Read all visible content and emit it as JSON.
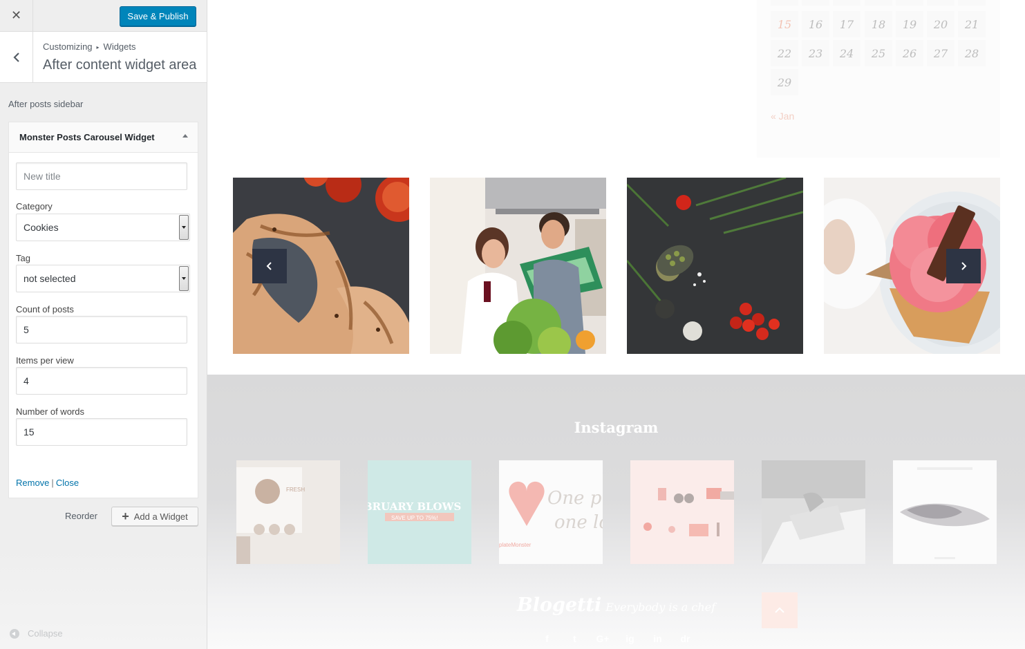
{
  "sidebar": {
    "publish_label": "Save & Publish",
    "breadcrumb_root": "Customizing",
    "breadcrumb_child": "Widgets",
    "section_title": "After content widget area",
    "area_description": "After posts sidebar",
    "reorder_label": "Reorder",
    "add_widget_label": "Add a Widget",
    "collapse_label": "Collapse"
  },
  "widget": {
    "title": "Monster Posts Carousel Widget",
    "title_field_placeholder": "New title",
    "category_label": "Category",
    "category_value": "Cookies",
    "tag_label": "Tag",
    "tag_value": "not selected",
    "count_label": "Count of posts",
    "count_value": "5",
    "items_label": "Items per view",
    "items_value": "4",
    "words_label": "Number of words",
    "words_value": "15",
    "remove_label": "Remove",
    "close_label": "Close"
  },
  "calendar": {
    "rows": [
      [
        "15",
        "16",
        "17",
        "18",
        "19",
        "20",
        "21"
      ],
      [
        "22",
        "23",
        "24",
        "25",
        "26",
        "27",
        "28"
      ],
      [
        "29"
      ]
    ],
    "today": "15",
    "prev_link": "« Jan"
  },
  "carousel": {
    "slides": [
      "grilled-salmon-heart",
      "couple-cooking",
      "spices-on-slate",
      "pink-cupcake"
    ]
  },
  "footer": {
    "instagram_title": "Instagram",
    "insta_texts": [
      "FRESH",
      "BRUARY BLOWS",
      "SAVE UP TO 75%!",
      "One pr",
      "one lo",
      "plateMonster"
    ],
    "logo": "Blogetti",
    "tagline": "Everybody is a chef",
    "socials": [
      "f",
      "t",
      "G+",
      "ig",
      "in",
      "dr"
    ]
  },
  "colors": {
    "publish": "#0085ba",
    "link": "#0073aa",
    "carousel_nav": "#2d3444"
  }
}
